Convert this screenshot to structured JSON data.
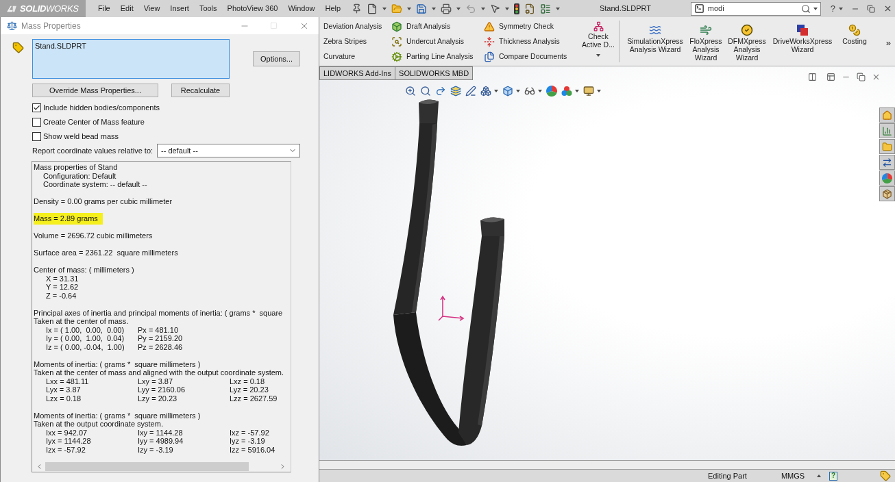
{
  "app_bar": {
    "logo": "**SOLID**WORKS",
    "menu": [
      "File",
      "Edit",
      "View",
      "Insert",
      "Tools",
      "PhotoView 360",
      "Window",
      "Help"
    ],
    "document_title": "Stand.SLDPRT",
    "search": {
      "value": "modi"
    },
    "help_glyph": "?"
  },
  "dialog": {
    "title": "Mass Properties",
    "selection": "Stand.SLDPRT",
    "options_button": "Options...",
    "buttons": [
      "Override Mass Properties...",
      "Recalculate"
    ],
    "checkboxes": [
      {
        "label": "Include hidden bodies/components",
        "checked": true
      },
      {
        "label": "Create Center of Mass feature",
        "checked": false
      },
      {
        "label": "Show weld bead mass",
        "checked": false
      }
    ],
    "coordinate_label": "Report coordinate values relative to:",
    "coordinate_select": {
      "value": "-- default --"
    },
    "report": [
      {
        "highlighted": false,
        "lines": [
          {
            "kind": "line",
            "text": "Mass properties of Stand"
          },
          {
            "kind": "sub",
            "text": "Configuration: Default"
          },
          {
            "kind": "sub",
            "text": "Coordinate system: -- default --"
          }
        ]
      },
      {
        "highlighted": false,
        "lines": [
          {
            "kind": "line",
            "text": "Density = 0.00 grams per cubic millimeter"
          }
        ]
      },
      {
        "highlighted": true,
        "lines": [
          {
            "kind": "line",
            "text": "Mass = 2.89 grams"
          }
        ]
      },
      {
        "highlighted": false,
        "lines": [
          {
            "kind": "line",
            "text": "Volume = 2696.72 cubic millimeters"
          }
        ]
      },
      {
        "highlighted": false,
        "lines": [
          {
            "kind": "line",
            "text": "Surface area = 2361.22  square millimeters"
          }
        ]
      },
      {
        "highlighted": false,
        "lines": [
          {
            "kind": "line",
            "text": "Center of mass: ( millimeters )"
          },
          {
            "kind": "row",
            "cells": [
              "X = 31.31"
            ]
          },
          {
            "kind": "row",
            "cells": [
              "Y = 12.62"
            ]
          },
          {
            "kind": "row",
            "cells": [
              "Z = -0.64"
            ]
          }
        ]
      },
      {
        "highlighted": false,
        "lines": [
          {
            "kind": "line",
            "text": "Principal axes of inertia and principal moments of inertia: ( grams *  square"
          },
          {
            "kind": "line",
            "text": "Taken at the center of mass."
          },
          {
            "kind": "row",
            "cells": [
              "Ix = ( 1.00,  0.00,  0.00)",
              "Px = 481.10"
            ]
          },
          {
            "kind": "row",
            "cells": [
              "Iy = ( 0.00,  1.00,  0.04)",
              "Py = 2159.20"
            ]
          },
          {
            "kind": "row",
            "cells": [
              "Iz = ( 0.00, -0.04,  1.00)",
              "Pz = 2628.46"
            ]
          }
        ]
      },
      {
        "highlighted": false,
        "lines": [
          {
            "kind": "line",
            "text": "Moments of inertia: ( grams *  square millimeters )"
          },
          {
            "kind": "line",
            "text": "Taken at the center of mass and aligned with the output coordinate system."
          },
          {
            "kind": "row",
            "cells": [
              "Lxx = 481.11",
              "Lxy = 3.87",
              "Lxz = 0.18"
            ]
          },
          {
            "kind": "row",
            "cells": [
              "Lyx = 3.87",
              "Lyy = 2160.06",
              "Lyz = 20.23"
            ]
          },
          {
            "kind": "row",
            "cells": [
              "Lzx = 0.18",
              "Lzy = 20.23",
              "Lzz = 2627.59"
            ]
          }
        ]
      },
      {
        "highlighted": false,
        "lines": [
          {
            "kind": "line",
            "text": "Moments of inertia: ( grams *  square millimeters )"
          },
          {
            "kind": "line",
            "text": "Taken at the output coordinate system."
          },
          {
            "kind": "row",
            "cells": [
              "Ixx = 942.07",
              "Ixy = 1144.28",
              "Ixz = -57.92"
            ]
          },
          {
            "kind": "row",
            "cells": [
              "Iyx = 1144.28",
              "Iyy = 4989.94",
              "Iyz = -3.19"
            ]
          },
          {
            "kind": "row",
            "cells": [
              "Izx = -57.92",
              "Izy = -3.19",
              "Izz = 5916.04"
            ]
          }
        ]
      }
    ]
  },
  "ribbon": {
    "tool_groups": [
      {
        "kind": "text",
        "items": [
          "Deviation Analysis",
          "Zebra Stripes",
          "Curvature"
        ]
      },
      {
        "kind": "icon",
        "items": [
          "Draft Analysis",
          "Undercut Analysis",
          "Parting Line Analysis"
        ]
      },
      {
        "kind": "icon",
        "items": [
          "Symmetry Check",
          "Thickness Analysis",
          "Compare Documents"
        ]
      }
    ],
    "check_button": "Check Active D...",
    "large_buttons": [
      "SimulationXpress Analysis Wizard",
      "FloXpress Analysis Wizard",
      "DFMXpress Analysis Wizard",
      "DriveWorksXpress Wizard",
      "Costing"
    ],
    "more_glyph": "»"
  },
  "tabs": [
    {
      "label": "LIDWORKS Add-Ins",
      "selected": false
    },
    {
      "label": "SOLIDWORKS MBD",
      "selected": false
    }
  ],
  "status_bar": {
    "mode": "Editing Part",
    "units": "MMGS",
    "help_glyph": "?"
  }
}
